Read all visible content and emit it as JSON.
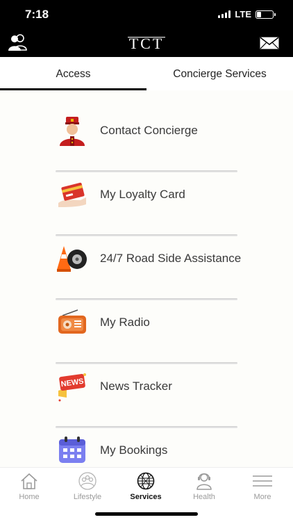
{
  "status_bar": {
    "time": "7:18",
    "network": "LTE",
    "battery_level": 0.25
  },
  "app_bar": {
    "logo_text": "TCT",
    "profile_icon": "profile-icon",
    "mail_icon": "mail-icon"
  },
  "tabs": [
    {
      "label": "Access",
      "active": true
    },
    {
      "label": "Concierge Services",
      "active": false
    }
  ],
  "menu": [
    {
      "label": "Contact Concierge",
      "icon": "concierge-icon"
    },
    {
      "label": "My Loyalty Card",
      "icon": "loyalty-card-icon"
    },
    {
      "label": "24/7 Road Side Assistance",
      "icon": "roadside-assistance-icon"
    },
    {
      "label": "My Radio",
      "icon": "radio-icon"
    },
    {
      "label": "News Tracker",
      "icon": "news-icon"
    },
    {
      "label": "My Bookings",
      "icon": "calendar-icon"
    }
  ],
  "icon_text": {
    "news": "NEWS"
  },
  "bottom_nav": [
    {
      "label": "Home",
      "icon": "home-icon",
      "active": false
    },
    {
      "label": "Lifestyle",
      "icon": "lifestyle-icon",
      "active": false
    },
    {
      "label": "Services",
      "icon": "globe-icon",
      "active": true
    },
    {
      "label": "Health",
      "icon": "health-icon",
      "active": false
    },
    {
      "label": "More",
      "icon": "menu-icon",
      "active": false
    }
  ],
  "colors": {
    "header_bg": "#000000",
    "tab_indicator": "#000000",
    "content_bg": "#fdfdfa"
  }
}
